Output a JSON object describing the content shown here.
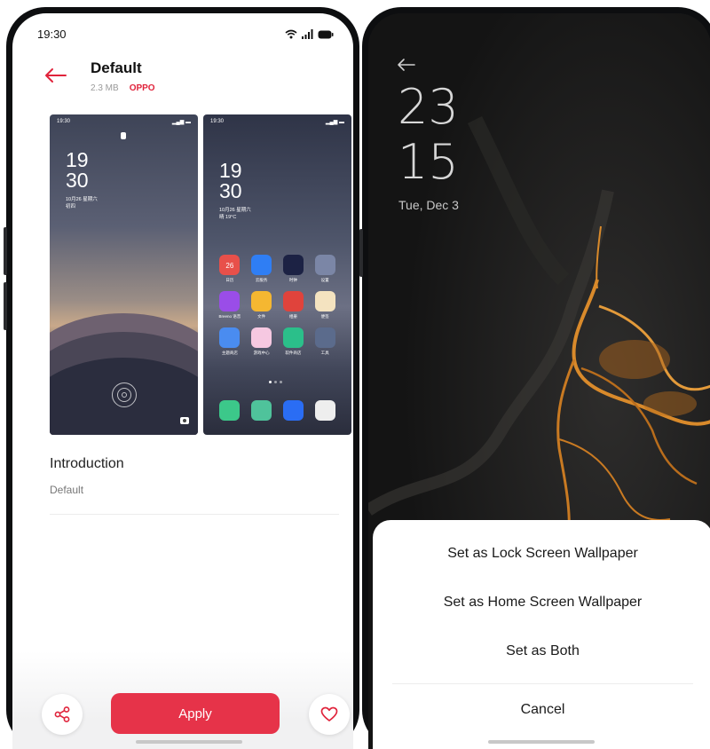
{
  "left_screen": {
    "status_bar": {
      "time": "19:30"
    },
    "header": {
      "title": "Default",
      "size": "2.3 MB",
      "vendor": "OPPO"
    },
    "lock_preview": {
      "status_time": "19:30",
      "clock_hour": "19",
      "clock_minute": "30",
      "date_line": "10月26 星期六",
      "lunar_line": "初四"
    },
    "home_preview": {
      "status_time": "19:30",
      "clock_hour": "19",
      "clock_minute": "30",
      "date_line": "10月26 星期六",
      "weather_line": "晴 19°C",
      "apps": [
        {
          "label": "日历",
          "color": "#e8504a",
          "icon": "calendar-icon",
          "text": "26"
        },
        {
          "label": "云服务",
          "color": "#2f7ef4",
          "icon": "cloud-icon",
          "text": ""
        },
        {
          "label": "时钟",
          "color": "#1c2244",
          "icon": "clock-icon",
          "text": ""
        },
        {
          "label": "设置",
          "color": "#7b86a6",
          "icon": "settings-icon",
          "text": ""
        },
        {
          "label": "Breeno 语音",
          "color": "#9a4de8",
          "icon": "voice-assistant-icon",
          "text": ""
        },
        {
          "label": "文件",
          "color": "#f5b731",
          "icon": "files-icon",
          "text": ""
        },
        {
          "label": "相册",
          "color": "#e0433c",
          "icon": "gallery-icon",
          "text": ""
        },
        {
          "label": "便签",
          "color": "#f4e3c0",
          "icon": "notes-icon",
          "text": ""
        },
        {
          "label": "主题商店",
          "color": "#4a8cf0",
          "icon": "theme-store-icon",
          "text": ""
        },
        {
          "label": "游戏中心",
          "color": "#f6c8e1",
          "icon": "game-center-icon",
          "text": ""
        },
        {
          "label": "软件商店",
          "color": "#2bbf8a",
          "icon": "app-store-icon",
          "text": ""
        },
        {
          "label": "工具",
          "color": "#5b6b8c",
          "icon": "tools-folder-icon",
          "text": ""
        }
      ],
      "dock": [
        {
          "color": "#3cc88a",
          "icon": "phone-icon"
        },
        {
          "color": "#4fc39b",
          "icon": "messages-icon"
        },
        {
          "color": "#2a6df4",
          "icon": "browser-icon"
        },
        {
          "color": "#eeeeee",
          "icon": "camera-icon"
        }
      ]
    },
    "intro": {
      "heading": "Introduction",
      "text": "Default"
    },
    "actions": {
      "apply_label": "Apply",
      "share_icon": "share-icon",
      "favorite_icon": "heart-icon"
    }
  },
  "right_screen": {
    "clock_hour": "23",
    "clock_minute": "15",
    "date": "Tue, Dec 3",
    "sheet": {
      "lock": "Set as Lock Screen Wallpaper",
      "home": "Set as Home Screen Wallpaper",
      "both": "Set as Both",
      "cancel": "Cancel"
    }
  },
  "colors": {
    "accent": "#e63349",
    "vendor": "#e0233b",
    "orange_art": "#d98a2b"
  }
}
